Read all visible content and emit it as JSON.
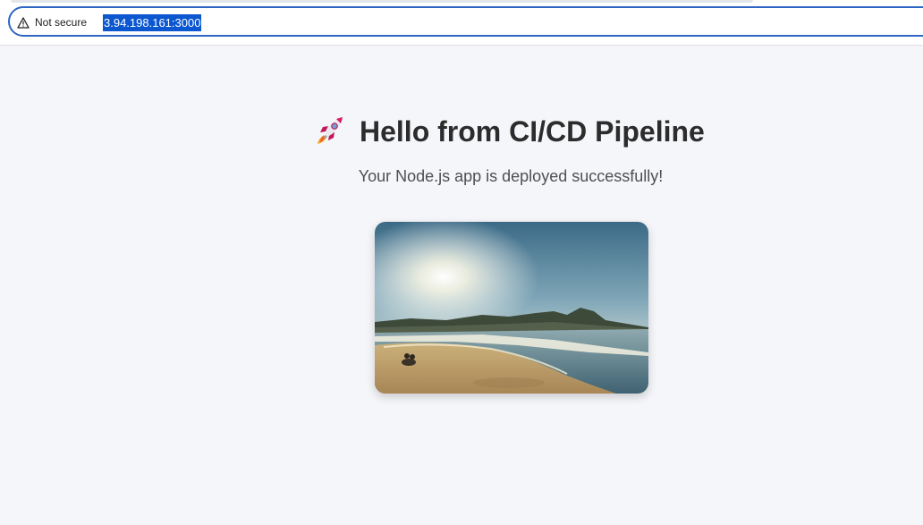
{
  "browser": {
    "security_label": "Not secure",
    "url": "3.94.198.161:3000",
    "accent_color": "#2f66c4"
  },
  "page": {
    "heading_icon": "rocket-icon",
    "heading": "Hello from CI/CD Pipeline",
    "subtitle": "Your Node.js app is deployed successfully!",
    "image": "beach-sunset-photo"
  }
}
